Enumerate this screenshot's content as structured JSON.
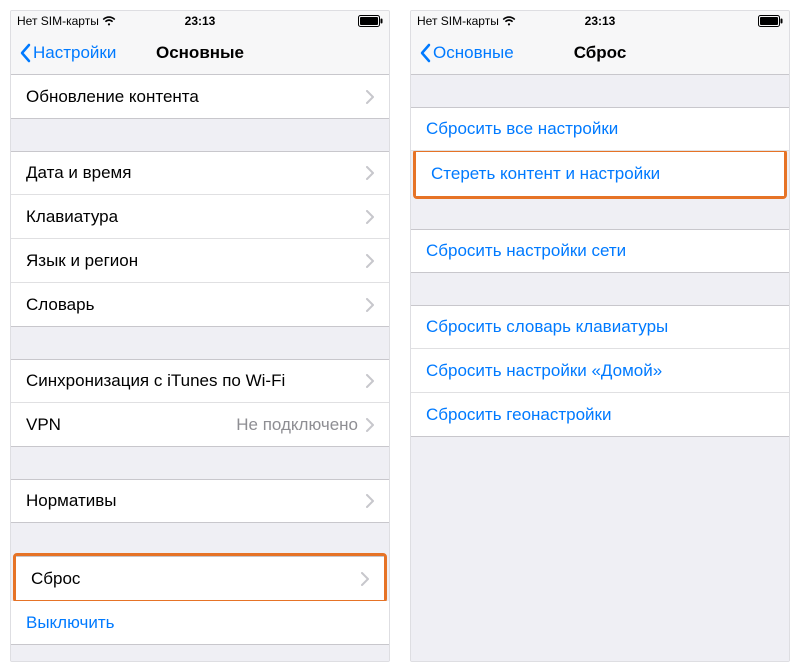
{
  "left": {
    "status": {
      "carrier": "Нет SIM-карты",
      "time": "23:13"
    },
    "nav": {
      "back": "Настройки",
      "title": "Основные"
    },
    "rows": {
      "content_update": "Обновление контента",
      "date_time": "Дата и время",
      "keyboard": "Клавиатура",
      "language": "Язык и регион",
      "dictionary": "Словарь",
      "itunes_wifi": "Синхронизация с iTunes по Wi-Fi",
      "vpn": "VPN",
      "vpn_status": "Не подключено",
      "regulatory": "Нормативы",
      "reset": "Сброс",
      "shutdown": "Выключить"
    }
  },
  "right": {
    "status": {
      "carrier": "Нет SIM-карты",
      "time": "23:13"
    },
    "nav": {
      "back": "Основные",
      "title": "Сброс"
    },
    "rows": {
      "reset_all": "Сбросить все настройки",
      "erase_all": "Стереть контент и настройки",
      "reset_network": "Сбросить настройки сети",
      "reset_keyboard": "Сбросить словарь клавиатуры",
      "reset_home": "Сбросить настройки «Домой»",
      "reset_location": "Сбросить геонастройки"
    }
  }
}
